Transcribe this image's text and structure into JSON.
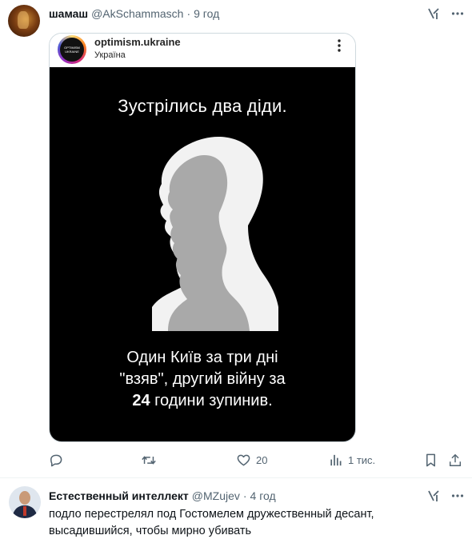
{
  "tweet1": {
    "author_name": "шамаш",
    "author_handle": "@AkSchammasch",
    "separator": "·",
    "time": "9 год",
    "embed": {
      "handle": "optimism.ukraine",
      "location": "Україна",
      "avatar_text_line1": "OPTIMISM",
      "avatar_text_line2": "UKRAINE",
      "poster_top_text": "Зустрілись два діди.",
      "poster_bottom_line1": "Один Київ за три дні",
      "poster_bottom_line2": "\"взяв\", другий війну за",
      "poster_bottom_line3_bold": "24",
      "poster_bottom_line3_rest": " години зупинив."
    },
    "actions": {
      "replies": "",
      "retweets": "",
      "likes": "20",
      "views": "1 тис."
    }
  },
  "tweet2": {
    "author_name": "Естественный интеллект",
    "author_handle": "@MZujev",
    "separator": "·",
    "time": "4 год",
    "text_line1": "подло перестрелял под Гостомелем дружественный десант,",
    "text_line2": "высадившийся, чтобы мирно убивать"
  },
  "icons": {
    "grok": "grok-icon",
    "more": "more-icon",
    "reply": "reply-icon",
    "retweet": "retweet-icon",
    "like": "like-icon",
    "views": "views-icon",
    "bookmark": "bookmark-icon",
    "share": "share-icon"
  },
  "colors": {
    "text": "#0f1419",
    "secondary": "#536471",
    "border": "#cfd9de",
    "poster_bg": "#000000",
    "silhouette_light": "#f2f2f2",
    "silhouette_dark": "#a9a9a9"
  }
}
